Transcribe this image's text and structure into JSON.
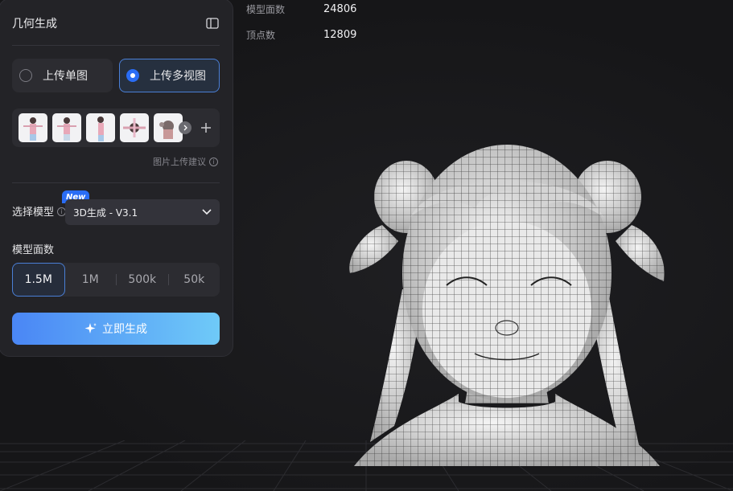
{
  "panel": {
    "title": "几何生成",
    "upload_modes": [
      {
        "label": "上传单图",
        "selected": false
      },
      {
        "label": "上传多视图",
        "selected": true
      }
    ],
    "upload_hint": "图片上传建议",
    "model_label": "选择模型",
    "new_badge": "New",
    "model_value": "3D生成 - V3.1",
    "faces_label": "模型面数",
    "faces_options": [
      "1.5M",
      "1M",
      "500k",
      "50k"
    ],
    "faces_selected": "1.5M",
    "generate_label": "立即生成"
  },
  "stats": [
    {
      "label": "模型面数",
      "value": "24806"
    },
    {
      "label": "顶点数",
      "value": "12809"
    }
  ],
  "icons": {
    "collapse": "sidebar-toggle-icon",
    "info": "info-icon",
    "add": "plus-icon",
    "chevron": "chevron-down-icon",
    "sparkle": "sparkle-icon",
    "more": "chevron-right-icon"
  },
  "colors": {
    "accent": "#2a6df5",
    "gradient_start": "#4a86f5",
    "gradient_end": "#6fcaf8",
    "panel_bg": "#232327",
    "viewport_bg": "#161618"
  }
}
